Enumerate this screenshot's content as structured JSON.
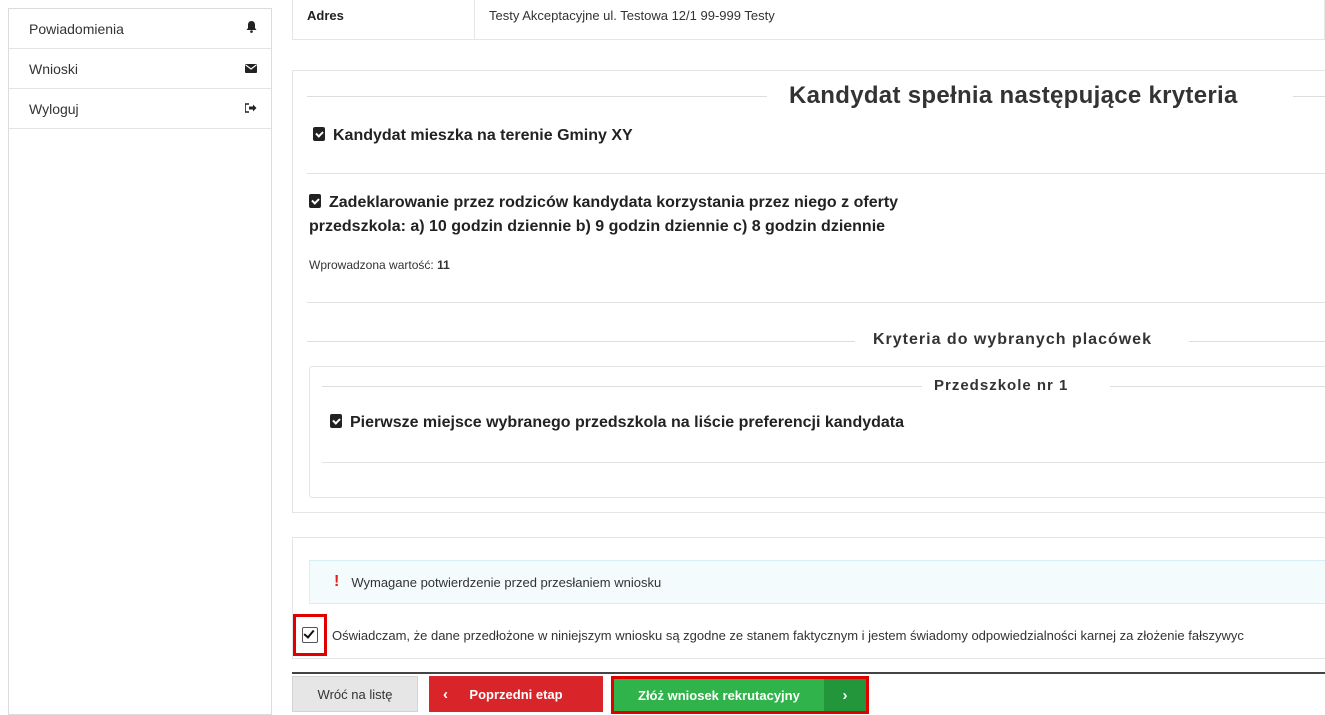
{
  "sidebar": {
    "items": [
      {
        "label": "Powiadomienia",
        "icon": "bell-icon",
        "glyph": "🔔"
      },
      {
        "label": "Wnioski",
        "icon": "envelope-icon",
        "glyph": "✉"
      },
      {
        "label": "Wyloguj",
        "icon": "sign-out-icon",
        "glyph": "⇥"
      }
    ]
  },
  "address": {
    "label": "Adres",
    "value": "Testy Akceptacyjne ul. Testowa 12/1 99-999 Testy"
  },
  "criteria": {
    "title": "Kandydat spełnia następujące kryteria",
    "items": [
      {
        "text": "Kandydat mieszka na terenie Gminy XY"
      },
      {
        "text_line1": "Zadeklarowanie przez rodziców kandydata korzystania przez niego z oferty",
        "text_line2": "przedszkola: a) 10 godzin dziennie b) 9 godzin dziennie c) 8 godzin dziennie",
        "entered_label": "Wprowadzona wartość:",
        "entered_value": "11"
      }
    ],
    "facility_section_title": "Kryteria do wybranych placówek",
    "facility": {
      "name": "Przedszkole nr 1",
      "items": [
        {
          "text": "Pierwsze miejsce wybranego przedszkola na liście preferencji kandydata"
        }
      ]
    }
  },
  "confirmation": {
    "alert_mark": "!",
    "alert_text": "Wymagane potwierdzenie przed przesłaniem wniosku",
    "declaration": "Oświadczam, że dane przedłożone w niniejszym wniosku są zgodne ze stanem faktycznym i jestem świadomy odpowiedzialności karnej za złożenie fałszywyc",
    "checked": true
  },
  "buttons": {
    "back": "Wróć na listę",
    "prev": "Poprzedni etap",
    "prev_chevron": "‹",
    "submit": "Złóż wniosek rekrutacyjny",
    "submit_chevron": "›"
  },
  "colors": {
    "danger": "#d9242a",
    "success": "#2fb34a",
    "highlight": "#e00000"
  }
}
